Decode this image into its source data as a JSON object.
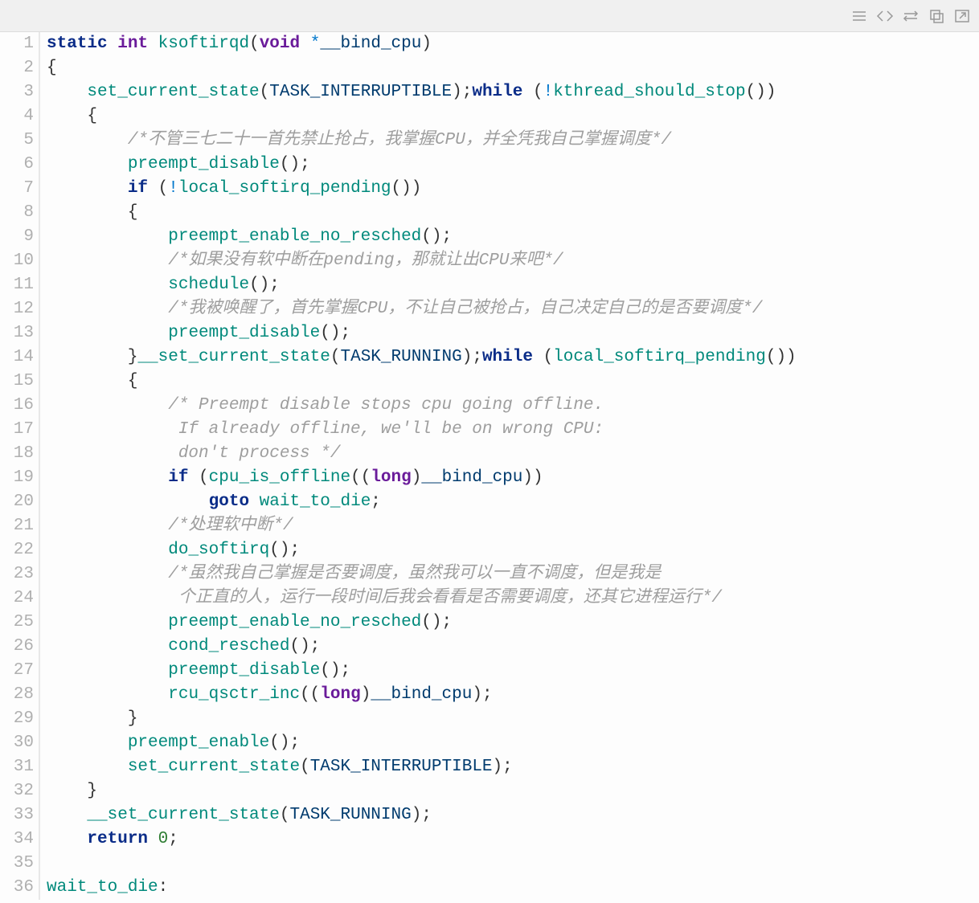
{
  "toolbar": {
    "icons": [
      "menu-icon",
      "code-icon",
      "swap-icon",
      "copy-icon",
      "popout-icon"
    ]
  },
  "code": {
    "lines": [
      {
        "n": 1,
        "t": "<span class='kw'>static</span> <span class='type'>int</span> <span class='fn'>ksoftirqd</span><span class='punc'>(</span><span class='type'>void</span> <span class='op'>*</span><span class='ident'>__bind_cpu</span><span class='punc'>)</span>"
      },
      {
        "n": 2,
        "t": "<span class='punc'>{</span>"
      },
      {
        "n": 3,
        "t": "    <span class='fn'>set_current_state</span><span class='punc'>(</span><span class='macro'>TASK_INTERRUPTIBLE</span><span class='punc'>);</span><span class='kw'>while</span> <span class='punc'>(</span><span class='op'>!</span><span class='fn'>kthread_should_stop</span><span class='punc'>())</span>"
      },
      {
        "n": 4,
        "t": "    <span class='punc'>{</span>"
      },
      {
        "n": 5,
        "t": "        <span class='comment'>/*不管三七二十一首先禁止抢占，我掌握CPU，并全凭我自己掌握调度*/</span>"
      },
      {
        "n": 6,
        "t": "        <span class='fn'>preempt_disable</span><span class='punc'>();</span>"
      },
      {
        "n": 7,
        "t": "        <span class='kw'>if</span> <span class='punc'>(</span><span class='op'>!</span><span class='fn'>local_softirq_pending</span><span class='punc'>())</span>"
      },
      {
        "n": 8,
        "t": "        <span class='punc'>{</span>"
      },
      {
        "n": 9,
        "t": "            <span class='fn'>preempt_enable_no_resched</span><span class='punc'>();</span>"
      },
      {
        "n": 10,
        "t": "            <span class='comment'>/*如果没有软中断在pending，那就让出CPU来吧*/</span>"
      },
      {
        "n": 11,
        "t": "            <span class='fn'>schedule</span><span class='punc'>();</span>"
      },
      {
        "n": 12,
        "t": "            <span class='comment'>/*我被唤醒了，首先掌握CPU，不让自己被抢占，自己决定自己的是否要调度*/</span>"
      },
      {
        "n": 13,
        "t": "            <span class='fn'>preempt_disable</span><span class='punc'>();</span>"
      },
      {
        "n": 14,
        "t": "        <span class='punc'>}</span><span class='fn'>__set_current_state</span><span class='punc'>(</span><span class='macro'>TASK_RUNNING</span><span class='punc'>);</span><span class='kw'>while</span> <span class='punc'>(</span><span class='fn'>local_softirq_pending</span><span class='punc'>())</span>"
      },
      {
        "n": 15,
        "t": "        <span class='punc'>{</span>"
      },
      {
        "n": 16,
        "t": "            <span class='comment'>/* Preempt disable stops cpu going offline.</span>"
      },
      {
        "n": 17,
        "t": "<span class='comment'>             If already offline, we'll be on wrong CPU:</span>"
      },
      {
        "n": 18,
        "t": "<span class='comment'>             don't process */</span>"
      },
      {
        "n": 19,
        "t": "            <span class='kw'>if</span> <span class='punc'>(</span><span class='fn'>cpu_is_offline</span><span class='punc'>((</span><span class='type'>long</span><span class='punc'>)</span><span class='ident'>__bind_cpu</span><span class='punc'>))</span>"
      },
      {
        "n": 20,
        "t": "                <span class='kw'>goto</span> <span class='fn'>wait_to_die</span><span class='punc'>;</span>"
      },
      {
        "n": 21,
        "t": "            <span class='comment'>/*处理软中断*/</span>"
      },
      {
        "n": 22,
        "t": "            <span class='fn'>do_softirq</span><span class='punc'>();</span>"
      },
      {
        "n": 23,
        "t": "            <span class='comment'>/*虽然我自己掌握是否要调度，虽然我可以一直不调度，但是我是</span>"
      },
      {
        "n": 24,
        "t": "<span class='comment'>             个正直的人，运行一段时间后我会看看是否需要调度，还其它进程运行*/</span>"
      },
      {
        "n": 25,
        "t": "            <span class='fn'>preempt_enable_no_resched</span><span class='punc'>();</span>"
      },
      {
        "n": 26,
        "t": "            <span class='fn'>cond_resched</span><span class='punc'>();</span>"
      },
      {
        "n": 27,
        "t": "            <span class='fn'>preempt_disable</span><span class='punc'>();</span>"
      },
      {
        "n": 28,
        "t": "            <span class='fn'>rcu_qsctr_inc</span><span class='punc'>((</span><span class='type'>long</span><span class='punc'>)</span><span class='ident'>__bind_cpu</span><span class='punc'>);</span>"
      },
      {
        "n": 29,
        "t": "        <span class='punc'>}</span>"
      },
      {
        "n": 30,
        "t": "        <span class='fn'>preempt_enable</span><span class='punc'>();</span>"
      },
      {
        "n": 31,
        "t": "        <span class='fn'>set_current_state</span><span class='punc'>(</span><span class='macro'>TASK_INTERRUPTIBLE</span><span class='punc'>);</span>"
      },
      {
        "n": 32,
        "t": "    <span class='punc'>}</span>"
      },
      {
        "n": 33,
        "t": "    <span class='fn'>__set_current_state</span><span class='punc'>(</span><span class='macro'>TASK_RUNNING</span><span class='punc'>);</span>"
      },
      {
        "n": 34,
        "t": "    <span class='kw'>return</span> <span class='num'>0</span><span class='punc'>;</span>"
      },
      {
        "n": 35,
        "t": ""
      },
      {
        "n": 36,
        "t": "<span class='label'>wait_to_die</span><span class='punc'>:</span>"
      }
    ]
  }
}
